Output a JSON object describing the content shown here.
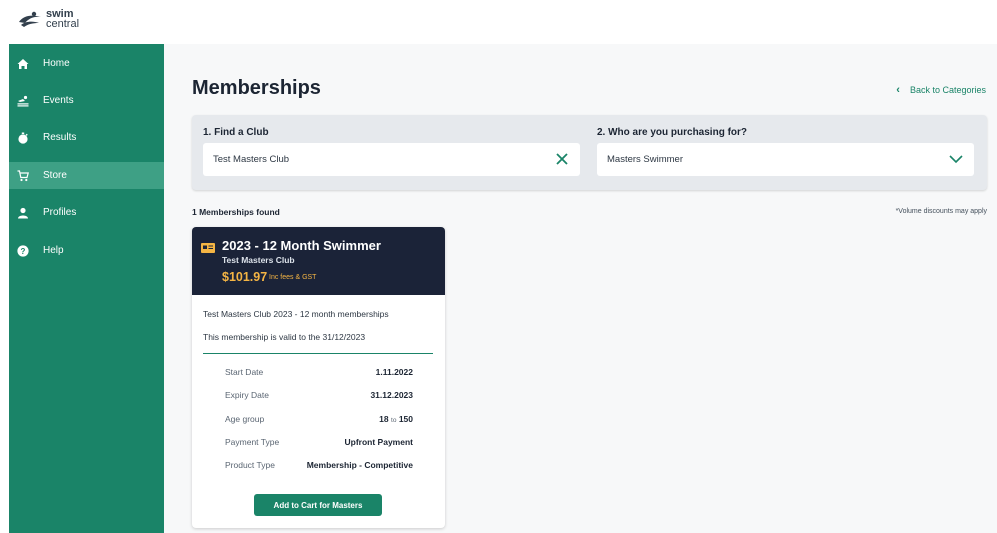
{
  "brand": {
    "line1": "swim",
    "line2": "central"
  },
  "sidebar": {
    "items": [
      {
        "label": "Home",
        "icon": "home-icon",
        "active": false
      },
      {
        "label": "Events",
        "icon": "swimmer-icon",
        "active": false
      },
      {
        "label": "Results",
        "icon": "stopwatch-icon",
        "active": false
      },
      {
        "label": "Store",
        "icon": "cart-icon",
        "active": true
      },
      {
        "label": "Profiles",
        "icon": "person-icon",
        "active": false
      },
      {
        "label": "Help",
        "icon": "help-icon",
        "active": false
      }
    ]
  },
  "page": {
    "title": "Memberships",
    "back_label": "Back to Categories"
  },
  "filters": {
    "club": {
      "label": "1. Find a Club",
      "value": "Test Masters Club"
    },
    "purchaser": {
      "label": "2. Who are you purchasing for?",
      "value": "Masters Swimmer"
    }
  },
  "results": {
    "count_text": "1 Memberships found",
    "note": "*Volume discounts may apply"
  },
  "card": {
    "title": "2023 - 12 Month Swimmer",
    "club": "Test Masters Club",
    "price": "$101.97",
    "price_note": "Inc fees & GST",
    "description": "Test Masters Club 2023 - 12 month memberships",
    "validity": "This membership is valid to the 31/12/2023",
    "details": {
      "start": {
        "label": "Start Date",
        "value": "1.11.2022"
      },
      "expiry": {
        "label": "Expiry Date",
        "value": "31.12.2023"
      },
      "age": {
        "label": "Age group",
        "min": "18",
        "sep": "to",
        "max": "150"
      },
      "payment": {
        "label": "Payment Type",
        "value": "Upfront Payment"
      },
      "product": {
        "label": "Product Type",
        "value": "Membership - Competitive"
      }
    },
    "button_label": "Add to Cart for Masters"
  },
  "colors": {
    "sidebar": "#1a8468",
    "sidebar_active": "#3ea085",
    "card_header": "#1b2338",
    "price": "#f5b544",
    "accent": "#1a8468"
  }
}
